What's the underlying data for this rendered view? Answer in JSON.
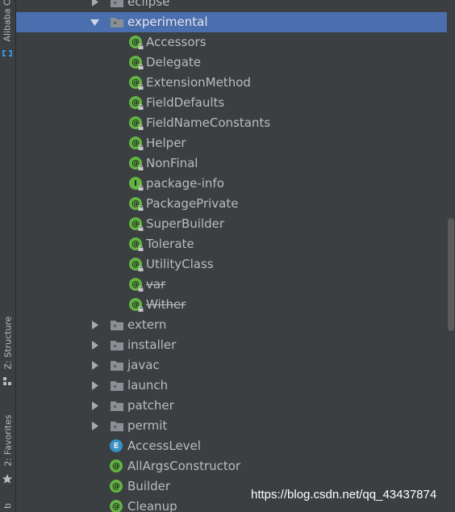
{
  "sidebar": {
    "tabs": [
      {
        "label": "Alibaba C",
        "icon": "alibaba-cloud-icon"
      },
      {
        "label": "Z: Structure",
        "icon": "structure-icon"
      },
      {
        "label": "2: Favorites",
        "icon": "favorites-star-icon"
      },
      {
        "label": "b"
      }
    ]
  },
  "tree": {
    "rows": [
      {
        "label": "eclipse",
        "type": "folder",
        "expanded": false,
        "indent": 1
      },
      {
        "label": "experimental",
        "type": "folder",
        "expanded": true,
        "selected": true,
        "indent": 1
      },
      {
        "label": "Accessors",
        "type": "annotation",
        "badge": "@",
        "indent": 2
      },
      {
        "label": "Delegate",
        "type": "annotation",
        "badge": "@",
        "indent": 2
      },
      {
        "label": "ExtensionMethod",
        "type": "annotation",
        "badge": "@",
        "indent": 2
      },
      {
        "label": "FieldDefaults",
        "type": "annotation",
        "badge": "@",
        "indent": 2
      },
      {
        "label": "FieldNameConstants",
        "type": "annotation",
        "badge": "@",
        "indent": 2
      },
      {
        "label": "Helper",
        "type": "annotation",
        "badge": "@",
        "indent": 2
      },
      {
        "label": "NonFinal",
        "type": "annotation",
        "badge": "@",
        "indent": 2
      },
      {
        "label": "package-info",
        "type": "interface",
        "badge": "I",
        "indent": 2
      },
      {
        "label": "PackagePrivate",
        "type": "annotation",
        "badge": "@",
        "indent": 2
      },
      {
        "label": "SuperBuilder",
        "type": "annotation",
        "badge": "@",
        "indent": 2
      },
      {
        "label": "Tolerate",
        "type": "annotation",
        "badge": "@",
        "indent": 2
      },
      {
        "label": "UtilityClass",
        "type": "annotation",
        "badge": "@",
        "indent": 2
      },
      {
        "label": "var",
        "type": "annotation",
        "badge": "@",
        "deprecated": true,
        "indent": 2
      },
      {
        "label": "Wither",
        "type": "annotation",
        "badge": "@",
        "deprecated": true,
        "indent": 2
      },
      {
        "label": "extern",
        "type": "folder",
        "expanded": false,
        "indent": 1
      },
      {
        "label": "installer",
        "type": "folder",
        "expanded": false,
        "indent": 1
      },
      {
        "label": "javac",
        "type": "folder",
        "expanded": false,
        "indent": 1
      },
      {
        "label": "launch",
        "type": "folder",
        "expanded": false,
        "indent": 1
      },
      {
        "label": "patcher",
        "type": "folder",
        "expanded": false,
        "indent": 1
      },
      {
        "label": "permit",
        "type": "folder",
        "expanded": false,
        "indent": 1
      },
      {
        "label": "AccessLevel",
        "type": "enum",
        "badge": "E",
        "indent": 0
      },
      {
        "label": "AllArgsConstructor",
        "type": "annotation",
        "badge": "@",
        "indent": 0
      },
      {
        "label": "Builder",
        "type": "annotation",
        "badge": "@",
        "indent": 0
      },
      {
        "label": "Cleanup",
        "type": "annotation",
        "badge": "@",
        "indent": 0
      }
    ]
  },
  "watermark": "https://blog.csdn.net/qq_43437874",
  "colors": {
    "background": "#3c3f41",
    "selection": "#4b6eaf",
    "text": "#bbbbbb",
    "annotation_badge": "#62b543",
    "enum_badge": "#3592c4"
  }
}
